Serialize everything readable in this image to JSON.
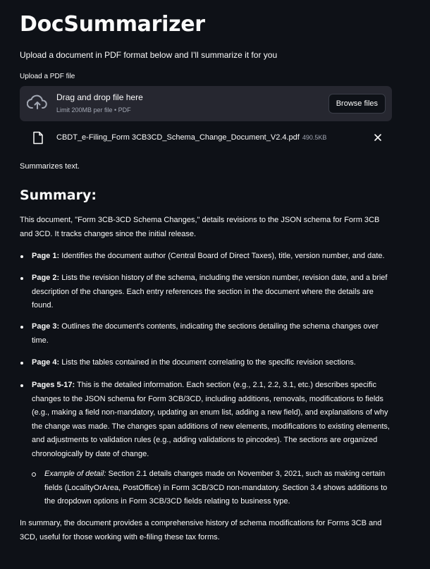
{
  "app": {
    "title": "DocSummarizer",
    "intro": "Upload a document in PDF format below and I'll summarize it for you"
  },
  "uploader": {
    "label": "Upload a PDF file",
    "drop_text": "Drag and drop file here",
    "limit_text": "Limit 200MB per file • PDF",
    "browse_label": "Browse files",
    "icon": "cloud-upload-icon"
  },
  "file": {
    "name": "CBDT_e-Filing_Form 3CB3CD_Schema_Change_Document_V2.4.pdf",
    "size": "490.5KB",
    "icon": "file-icon"
  },
  "note": "Summarizes text.",
  "summary": {
    "heading": "Summary:",
    "intro": "This document, \"Form 3CB-3CD Schema Changes,\" details revisions to the JSON schema for Form 3CB and 3CD. It tracks changes since the initial release.",
    "bullets": [
      {
        "label": "Page 1:",
        "text": " Identifies the document author (Central Board of Direct Taxes), title, version number, and date."
      },
      {
        "label": "Page 2:",
        "text": " Lists the revision history of the schema, including the version number, revision date, and a brief description of the changes. Each entry references the section in the document where the details are found."
      },
      {
        "label": "Page 3:",
        "text": " Outlines the document's contents, indicating the sections detailing the schema changes over time."
      },
      {
        "label": "Page 4:",
        "text": " Lists the tables contained in the document correlating to the specific revision sections."
      },
      {
        "label": "Pages 5-17:",
        "text": " This is the detailed information. Each section (e.g., 2.1, 2.2, 3.1, etc.) describes specific changes to the JSON schema for Form 3CB/3CD, including additions, removals, modifications to fields (e.g., making a field non-mandatory, updating an enum list, adding a new field), and explanations of why the change was made. The changes span additions of new elements, modifications to existing elements, and adjustments to validation rules (e.g., adding validations to pincodes). The sections are organized chronologically by date of change."
      }
    ],
    "sub_bullet": {
      "label": "Example of detail:",
      "text": " Section 2.1 details changes made on November 3, 2021, such as making certain fields (LocalityOrArea, PostOffice) in Form 3CB/3CD non-mandatory. Section 3.4 shows additions to the dropdown options in Form 3CB/3CD fields relating to business type."
    },
    "conclusion": "In summary, the document provides a comprehensive history of schema modifications for Forms 3CB and 3CD, useful for those working with e-filing these tax forms."
  }
}
